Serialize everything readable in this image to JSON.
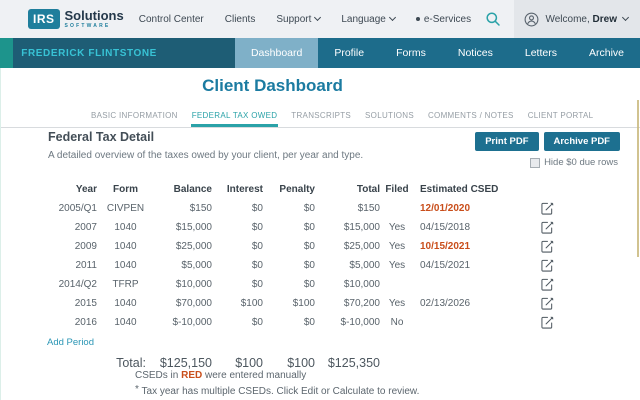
{
  "topbar": {
    "logo": {
      "mark": "IRS",
      "name": "Solutions",
      "sub": "SOFTWARE"
    },
    "nav": {
      "control_center": "Control Center",
      "clients": "Clients",
      "support": "Support",
      "language": "Language",
      "eservices": "e-Services"
    },
    "welcome_prefix": "Welcome, ",
    "user": "Drew"
  },
  "clientbar": {
    "client_name": "FREDERICK FLINTSTONE",
    "tabs": [
      {
        "label": "Dashboard",
        "active": true
      },
      {
        "label": "Profile",
        "active": false
      },
      {
        "label": "Forms",
        "active": false
      },
      {
        "label": "Notices",
        "active": false
      },
      {
        "label": "Letters",
        "active": false
      },
      {
        "label": "Archive",
        "active": false
      }
    ]
  },
  "page": {
    "title": "Client Dashboard"
  },
  "page_tabs": [
    {
      "label": "BASIC INFORMATION",
      "active": false
    },
    {
      "label": "FEDERAL TAX OWED",
      "active": true
    },
    {
      "label": "TRANSCRIPTS",
      "active": false
    },
    {
      "label": "SOLUTIONS",
      "active": false
    },
    {
      "label": "COMMENTS / NOTES",
      "active": false
    },
    {
      "label": "CLIENT PORTAL",
      "active": false
    }
  ],
  "section": {
    "heading": "Federal Tax Detail",
    "subtitle": "A detailed overview of the taxes owed by your client, per year and type.",
    "print_button": "Print PDF",
    "archive_button": "Archive PDF",
    "hide_zero_label": "Hide $0 due rows"
  },
  "table": {
    "headers": [
      "Year",
      "Form",
      "Balance",
      "Interest",
      "Penalty",
      "Total",
      "Filed",
      "Estimated CSED"
    ],
    "rows": [
      {
        "year": "2005/Q1",
        "form": "CIVPEN",
        "balance": "$150",
        "interest": "$0",
        "penalty": "$0",
        "total": "$150",
        "filed": "",
        "estimated_csed": "12/01/2020",
        "csed_red": true
      },
      {
        "year": "2007",
        "form": "1040",
        "balance": "$15,000",
        "interest": "$0",
        "penalty": "$0",
        "total": "$15,000",
        "filed": "Yes",
        "estimated_csed": "04/15/2018",
        "csed_red": false
      },
      {
        "year": "2009",
        "form": "1040",
        "balance": "$25,000",
        "interest": "$0",
        "penalty": "$0",
        "total": "$25,000",
        "filed": "Yes",
        "estimated_csed": "10/15/2021",
        "csed_red": true
      },
      {
        "year": "2011",
        "form": "1040",
        "balance": "$5,000",
        "interest": "$0",
        "penalty": "$0",
        "total": "$5,000",
        "filed": "Yes",
        "estimated_csed": "04/15/2021",
        "csed_red": false
      },
      {
        "year": "2014/Q2",
        "form": "TFRP",
        "balance": "$10,000",
        "interest": "$0",
        "penalty": "$0",
        "total": "$10,000",
        "filed": "",
        "estimated_csed": "",
        "csed_red": false
      },
      {
        "year": "2015",
        "form": "1040",
        "balance": "$70,000",
        "interest": "$100",
        "penalty": "$100",
        "total": "$70,200",
        "filed": "Yes",
        "estimated_csed": "02/13/2026",
        "csed_red": false
      },
      {
        "year": "2016",
        "form": "1040",
        "balance": "$-10,000",
        "interest": "$0",
        "penalty": "$0",
        "total": "$-10,000",
        "filed": "No",
        "estimated_csed": "",
        "csed_red": false
      }
    ],
    "add_period_label": "Add Period",
    "total_label": "Total:",
    "totals": {
      "balance": "$125,150",
      "interest": "$100",
      "penalty": "$100",
      "total": "$125,350"
    }
  },
  "notes": {
    "line1_prefix": "CSEDs in ",
    "line1_red": "RED",
    "line1_suffix": " were entered manually",
    "line2_star": "*",
    "line2_text": " Tax year has multiple CSEDs. Click Edit or Calculate to review."
  },
  "colors": {
    "accent_button_teal": "#1d7090",
    "nav_blue": "#1d6c8b",
    "client_name_bg": "#1e5d75",
    "active_client_tab": "#7fb0c8",
    "green_accent": "#1d948c",
    "red_csed": "#c94e1b",
    "link_teal": "#2b96b5",
    "title_teal": "#1b7ba1",
    "active_page_tab": "#2aa2a8"
  }
}
